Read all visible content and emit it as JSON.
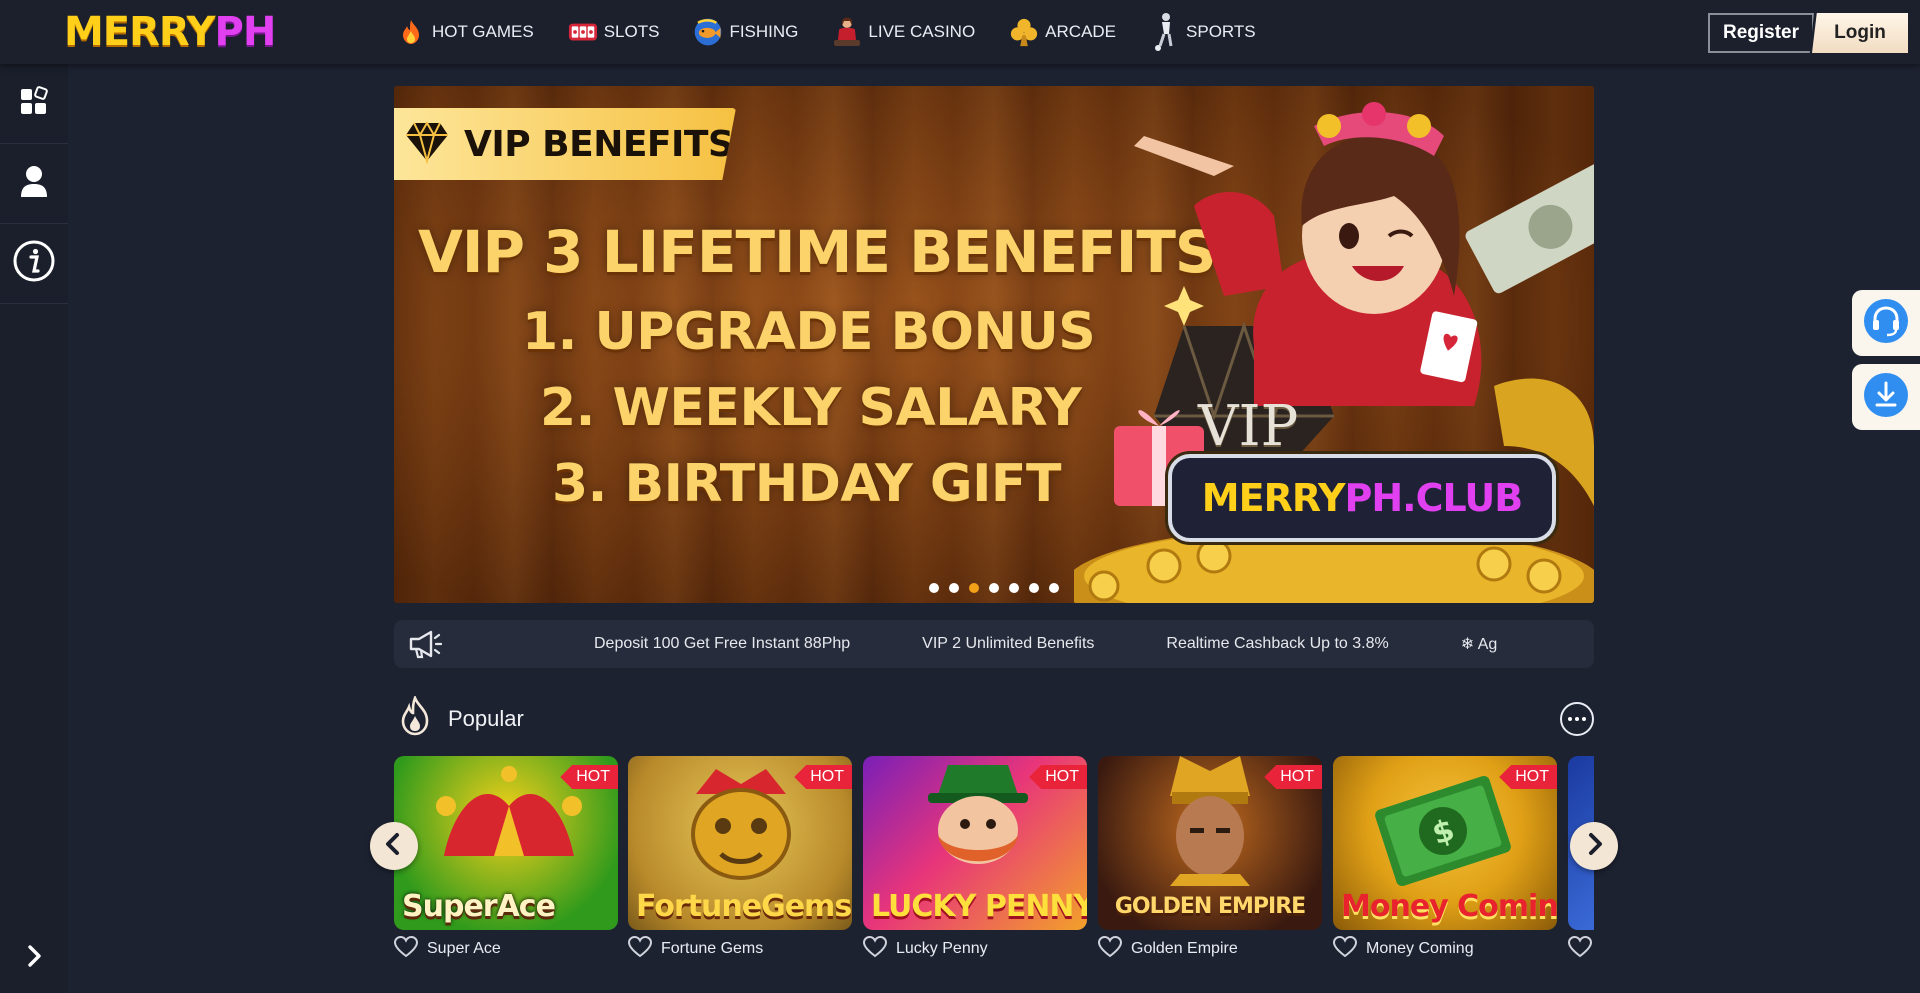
{
  "brand": {
    "logo_part1": "MERRY",
    "logo_part2": "PH",
    "logo_color1": "#ffcf1a",
    "logo_color2": "#e040f0"
  },
  "nav": {
    "items": [
      {
        "label": "HOT GAMES",
        "icon": "flame-icon"
      },
      {
        "label": "SLOTS",
        "icon": "slot-machine-icon"
      },
      {
        "label": "FISHING",
        "icon": "fish-icon"
      },
      {
        "label": "LIVE CASINO",
        "icon": "dealer-icon"
      },
      {
        "label": "ARCADE",
        "icon": "clover-icon"
      },
      {
        "label": "SPORTS",
        "icon": "athlete-icon"
      }
    ]
  },
  "auth": {
    "register_label": "Register",
    "login_label": "Login"
  },
  "sidebar": {
    "items": [
      "apps-icon",
      "user-icon",
      "info-icon"
    ],
    "expand_icon": "chevron-right-icon"
  },
  "banner": {
    "tag": "VIP BENEFITS",
    "headline": "VIP 3 LIFETIME BENEFITS",
    "line1": "1. UPGRADE BONUS",
    "line2": "2. WEEKLY SALARY",
    "line3": "3. BIRTHDAY GIFT",
    "badge_vip": "VIP",
    "badge_part1": "MERRY",
    "badge_part2": "PH.CLUB",
    "slide_count": 7,
    "active_slide": 3
  },
  "marquee": {
    "icon": "megaphone-icon",
    "items": [
      " Deposit 100 Get Free Instant 88Php ",
      " VIP 2 Unlimited Benefits ",
      " Realtime Cashback Up to 3.8%",
      "❄ Ag"
    ]
  },
  "popular": {
    "title": "Popular",
    "hot_label": "HOT",
    "games": [
      {
        "name": "Super Ace",
        "art_title": "SuperAce",
        "bg1": "#2f9a1c",
        "bg2": "#f7d11b",
        "title_color": "#fff3c4"
      },
      {
        "name": "Fortune Gems",
        "art_title": "FortuneGems",
        "bg1": "#b98a2a",
        "bg2": "#e6c75a",
        "title_color": "#ffd84a"
      },
      {
        "name": "Lucky Penny",
        "art_title": "LUCKY PENNY",
        "bg1": "#7a1fb8",
        "bg2": "#f2a12a",
        "title_color": "#ffdf3b"
      },
      {
        "name": "Golden Empire",
        "art_title": "GOLDEN EMPIRE",
        "bg1": "#3a1a10",
        "bg2": "#c06a1e",
        "title_color": "#ffd76a"
      },
      {
        "name": "Money Coming",
        "art_title": "Money Coming",
        "bg1": "#e0a016",
        "bg2": "#2d8b2d",
        "title_color": "#e8232e"
      },
      {
        "name": "",
        "art_title": "",
        "bg1": "#1a3aa0",
        "bg2": "#d85a1a",
        "title_color": "#ffffff"
      }
    ]
  },
  "floating": {
    "support_icon": "headset-icon",
    "download_icon": "download-icon",
    "accent": "#2f8ef0"
  }
}
